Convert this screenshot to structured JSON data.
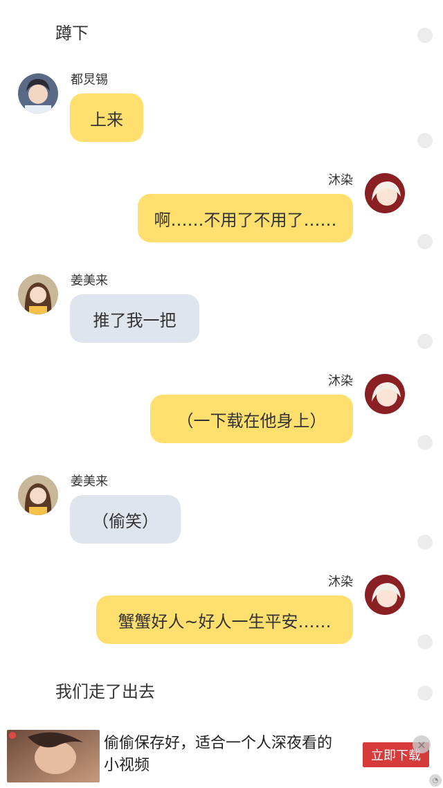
{
  "messages": [
    {
      "type": "narration",
      "text": "蹲下"
    },
    {
      "type": "left",
      "name": "都炅锡",
      "text": "上来",
      "bubble": "yellow"
    },
    {
      "type": "right",
      "name": "沐染",
      "text": "啊……不用了不用了……"
    },
    {
      "type": "left",
      "name": "姜美来",
      "text": "推了我一把",
      "bubble": "gray"
    },
    {
      "type": "right",
      "name": "沐染",
      "text": "（一下载在他身上）"
    },
    {
      "type": "left",
      "name": "姜美来",
      "text": "（偷笑）",
      "bubble": "gray"
    },
    {
      "type": "right",
      "name": "沐染",
      "text": "蟹蟹好人~好人一生平安……"
    },
    {
      "type": "narration",
      "text": "我们走了出去"
    }
  ],
  "ad": {
    "text": "偷偷保存好，适合一个人深夜看的小视频",
    "button": "立即下载",
    "close": "×"
  },
  "colors": {
    "yellow_bubble": "#ffdf6e",
    "gray_bubble": "#dfe5ec",
    "ad_button": "#d63b3b"
  }
}
